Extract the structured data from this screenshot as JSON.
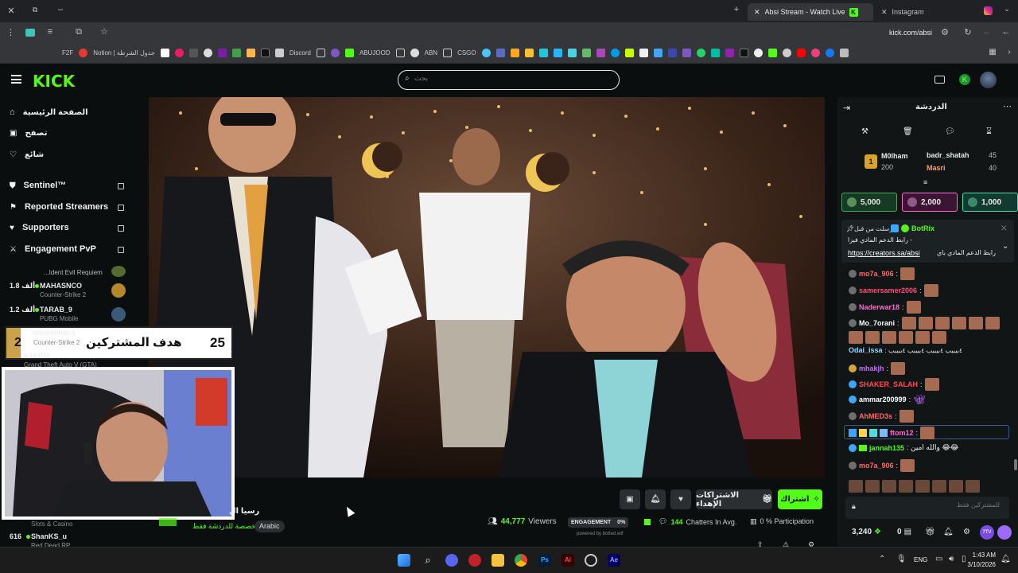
{
  "browser": {
    "tabs": [
      {
        "label": "Absi Stream - Watch Live on K",
        "active": true
      },
      {
        "label": "Instagram",
        "active": false
      }
    ],
    "url": "kick.com/absi",
    "bookmarks": [
      "F2F",
      "Notion | جدول الشرطة",
      "Discord",
      "ABUJOOD",
      "ABN",
      "CSGO"
    ]
  },
  "header": {
    "logo": "KICK",
    "search_placeholder": "بحث"
  },
  "sidebar": {
    "nav": [
      {
        "label": "الصفحة الرئيسية",
        "icon": "home-icon"
      },
      {
        "label": "تصفح",
        "icon": "browse-icon"
      },
      {
        "label": "شائع",
        "icon": "heart-icon"
      }
    ],
    "extensions": [
      {
        "label": "Sentinel™",
        "icon": "shield-icon"
      },
      {
        "label": "Reported Streamers",
        "icon": "flag-icon"
      },
      {
        "label": "Supporters",
        "icon": "heart-icon"
      },
      {
        "label": "Engagement PvP",
        "icon": "swords-icon"
      }
    ],
    "streamers": [
      {
        "name": "...Ident Evil Requiem",
        "game": "",
        "viewers": ""
      },
      {
        "name": "MAHASNCO",
        "game": "Counter-Strike 2",
        "viewers": "1.8 ألف"
      },
      {
        "name": "TARAB_9",
        "game": "PUBG Mobile",
        "viewers": "1.2 ألف"
      },
      {
        "name": "nonolinhocs",
        "game": "Counter-Strike 2",
        "viewers": ""
      },
      {
        "name": "K1KRM",
        "game": "Grand Theft Auto V (GTA)",
        "viewers": ""
      },
      {
        "name": "ShanKS_u",
        "game": "Red Dead RP",
        "viewers": "616"
      }
    ],
    "partial_text_slots": "Slots & Casino"
  },
  "overlay": {
    "goal_label": "هدف المشتركين",
    "goal_value": "25",
    "goal_prefix": "2"
  },
  "stream_info": {
    "title": "رسيا ال",
    "tag_note": "مخصصة للدردشة فقط",
    "language": "Arabic",
    "viewers_count": "44,777",
    "viewers_label": "Viewers",
    "engagement_label": "ENGAGEMENT",
    "engagement_value": "0%",
    "chatters": "144",
    "chatters_label": "Chatters In Avg.",
    "participation": "0 % Participation",
    "powered_by": "powered by botted.wtf",
    "subscribe_label": "اشتراك",
    "gift_label": "الاشتراكات الإهداء"
  },
  "chat": {
    "title": "الدردشة",
    "leaderboard": [
      {
        "name": "M0lham",
        "score": "200",
        "rank": "1"
      },
      {
        "name": "badr_shatah",
        "score": "45"
      },
      {
        "name": "Masri",
        "score": "40"
      }
    ],
    "gifts": [
      "5,000",
      "2,000",
      "1,000"
    ],
    "pinned": {
      "pinned_by": "أرسلت من قبل",
      "author": "BotRix",
      "line1": "رابط الدعم المادي فيزا -",
      "link": "https://creators.sa/absi",
      "line2": "رابط الدعم المادي باي"
    },
    "messages": [
      {
        "user": "mo7a_906",
        "color": "#ff6b6b",
        "text": ""
      },
      {
        "user": "samersamer2006",
        "color": "#ff4d7a",
        "text": ""
      },
      {
        "user": "Naderwar18",
        "color": "#ff6bd5",
        "text": ""
      },
      {
        "user": "Mo_7orani",
        "color": "#ffffff",
        "text": ""
      },
      {
        "user": "Odai_issa",
        "color": "#9ad9ff",
        "text": ": ٤ببببب ٤ببببب ٤ببببب ٤ببببب"
      },
      {
        "user": "mhakjh",
        "color": "#c96bff",
        "text": ""
      },
      {
        "user": "SHAKER_SALAH",
        "color": "#ff4d4d",
        "text": ""
      },
      {
        "user": "ammar200999",
        "color": "#ffffff",
        "text": ""
      },
      {
        "user": "AhMED3s",
        "color": "#ff6b6b",
        "text": ""
      },
      {
        "user": "ftom12",
        "color": "#ff6bd5",
        "text": ""
      },
      {
        "user": "jannah135",
        "color": "#53fc18",
        "text": ": والله امين 😂😂"
      },
      {
        "user": "mo7a_906",
        "color": "#ff6b6b",
        "text": ""
      }
    ],
    "input_placeholder": "للمشتركين فقط",
    "points": "3,240",
    "zero": "0",
    "badge_7tv": "7TV"
  },
  "taskbar": {
    "lang": "ENG",
    "time": "1:43 AM",
    "date": "3/10/2026"
  }
}
